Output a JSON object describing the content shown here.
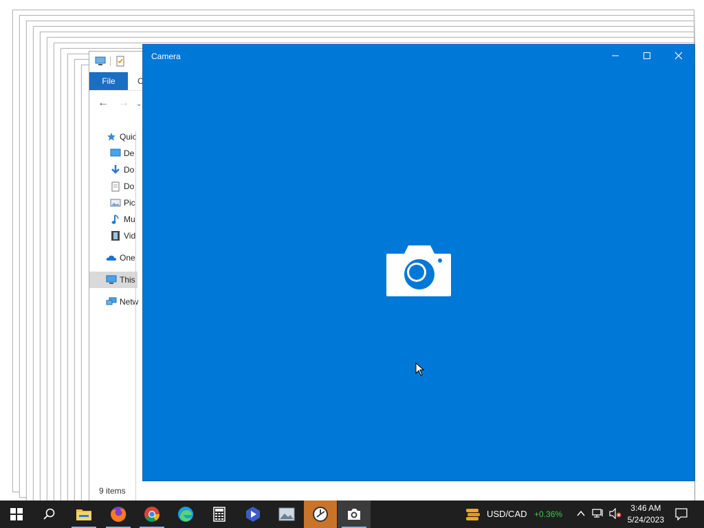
{
  "camera_window": {
    "title": "Camera",
    "controls": [
      "minimize",
      "maximize",
      "close"
    ],
    "center_icon": "camera-icon"
  },
  "explorer_window": {
    "ribbon_file_tab": "File",
    "ribbon_next_tab_partial": "C",
    "sidebar": [
      {
        "label": "Quic",
        "icon": "star-icon"
      },
      {
        "label": "De",
        "icon": "desktop-icon"
      },
      {
        "label": "Do",
        "icon": "download-icon"
      },
      {
        "label": "Do",
        "icon": "document-icon"
      },
      {
        "label": "Pic",
        "icon": "pictures-icon"
      },
      {
        "label": "Mu",
        "icon": "music-icon"
      },
      {
        "label": "Vid",
        "icon": "videos-icon"
      },
      {
        "label": "One",
        "icon": "onedrive-icon"
      },
      {
        "label": "This",
        "icon": "this-pc-icon"
      },
      {
        "label": "Netw",
        "icon": "network-icon"
      }
    ],
    "status": "9 items"
  },
  "taskbar": {
    "apps": [
      "Start",
      "Search",
      "File Explorer",
      "Firefox",
      "Chrome",
      "Edge",
      "Calculator",
      "Video Editor",
      "Photos",
      "Clock",
      "Camera"
    ],
    "ticker": {
      "symbol": "USD/CAD",
      "change": "+0.36%",
      "change_color": "#3ec94b"
    },
    "clock": {
      "time": "3:46 AM",
      "date": "5/24/2023"
    }
  },
  "colors": {
    "camera_bg": "#0078d7",
    "taskbar_bg": "#1f1f1f"
  }
}
